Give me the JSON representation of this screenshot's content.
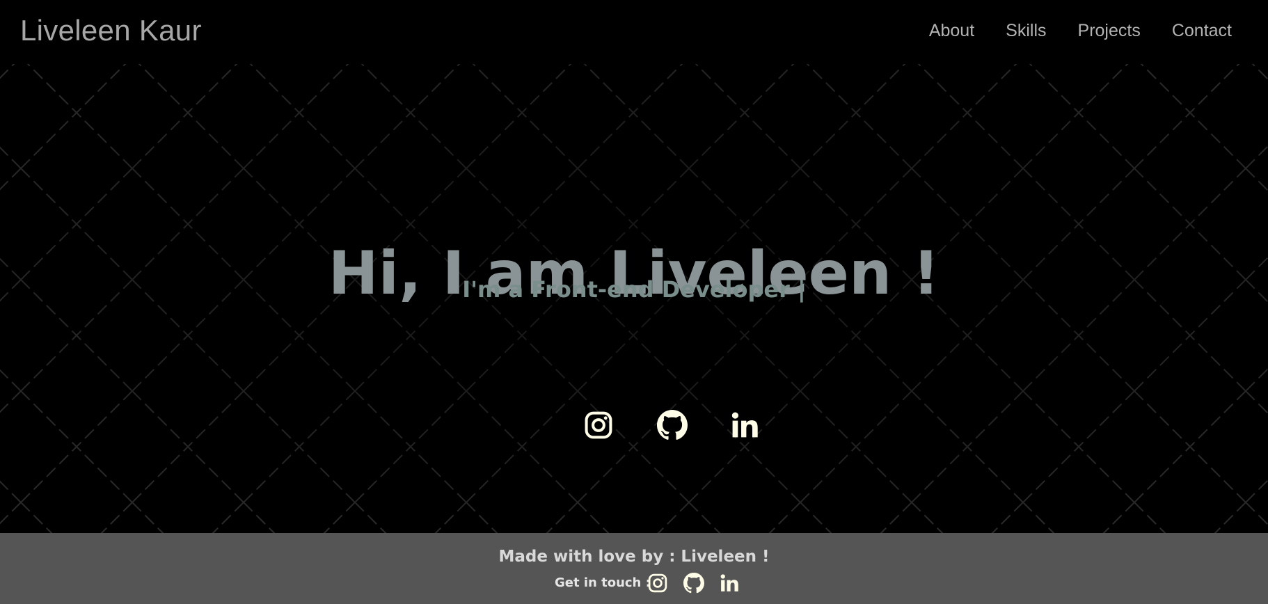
{
  "header": {
    "brand": "Liveleen Kaur",
    "nav": [
      {
        "label": "About"
      },
      {
        "label": "Skills"
      },
      {
        "label": "Projects"
      },
      {
        "label": "Contact"
      }
    ]
  },
  "hero": {
    "title": "Hi, I am Liveleen !",
    "subtitle": "I'm a Front-end Developer |",
    "socials": [
      {
        "icon": "instagram-icon"
      },
      {
        "icon": "github-icon"
      },
      {
        "icon": "linkedin-icon"
      }
    ]
  },
  "footer": {
    "made_with": "Made with love by : Liveleen !",
    "get_in_touch": "Get in touch :",
    "socials": [
      {
        "icon": "instagram-icon"
      },
      {
        "icon": "github-icon"
      },
      {
        "icon": "linkedin-icon"
      }
    ]
  },
  "colors": {
    "background": "#000000",
    "brand_text": "#a7a7a7",
    "nav_text": "#b3b3b3",
    "hero_title": "#8a9395",
    "hero_subtitle": "#7a8e8b",
    "icon": "#fffde8",
    "footer_bg": "#555555",
    "footer_text": "#d9d9d9"
  }
}
